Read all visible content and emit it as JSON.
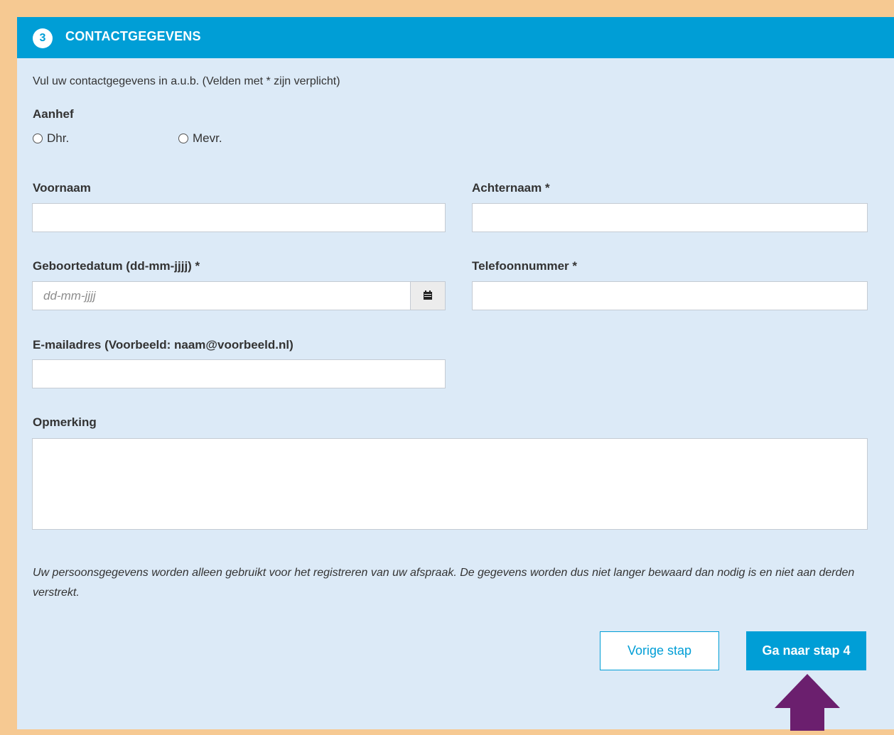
{
  "header": {
    "step_number": "3",
    "title": "CONTACTGEGEVENS"
  },
  "intro": "Vul uw contactgegevens in a.u.b. (Velden met * zijn verplicht)",
  "salutation": {
    "label": "Aanhef",
    "options": [
      {
        "label": "Dhr."
      },
      {
        "label": "Mevr."
      }
    ]
  },
  "fields": {
    "first_name": {
      "label": "Voornaam",
      "value": ""
    },
    "last_name": {
      "label": "Achternaam *",
      "value": ""
    },
    "birthdate": {
      "label": "Geboortedatum (dd-mm-jjjj) *",
      "placeholder": "dd-mm-jjjj",
      "value": ""
    },
    "phone": {
      "label": "Telefoonnummer *",
      "value": ""
    },
    "email": {
      "label": "E-mailadres (Voorbeeld: naam@voorbeeld.nl)",
      "value": ""
    },
    "remark": {
      "label": "Opmerking",
      "value": ""
    }
  },
  "privacy_text": "Uw persoonsgegevens worden alleen gebruikt voor het registreren van uw afspraak. De gegevens worden dus niet langer bewaard dan nodig is en niet aan derden verstrekt.",
  "buttons": {
    "previous": "Vorige stap",
    "next": "Ga naar stap 4"
  },
  "colors": {
    "accent": "#009ed6",
    "panel_bg": "#dceaf7",
    "frame": "#f6c992",
    "arrow": "#6b1f6e"
  },
  "icons": {
    "calendar": "calendar-icon",
    "arrow": "arrow-up-icon"
  }
}
